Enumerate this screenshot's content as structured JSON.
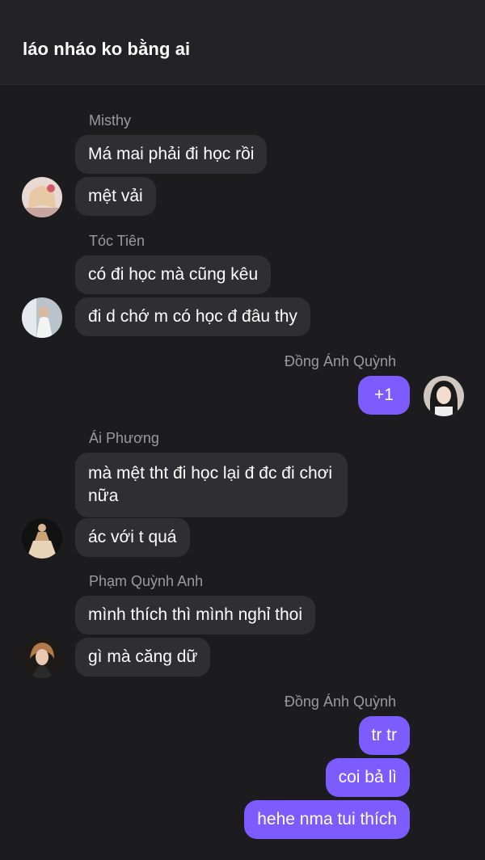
{
  "header": {
    "title": "láo nháo ko bằng ai"
  },
  "messages": {
    "g1": {
      "sender": "Misthy",
      "texts": [
        "Má mai phải đi học rồi",
        "mệt vải"
      ]
    },
    "g2": {
      "sender": "Tóc Tiên",
      "texts": [
        "có đi học mà cũng kêu",
        "đi d chớ m có học đ đâu thy"
      ]
    },
    "g3": {
      "sender": "Đồng Ánh Quỳnh",
      "texts": [
        "+1"
      ]
    },
    "g4": {
      "sender": "Ái Phương",
      "texts": [
        "mà mệt tht đi học lại đ đc đi chơi nữa",
        "ác với t quá"
      ]
    },
    "g5": {
      "sender": "Phạm Quỳnh Anh",
      "texts": [
        "mình thích thì mình nghỉ thoi",
        "gì mà căng dữ"
      ]
    },
    "g6": {
      "sender": "Đồng Ánh Quỳnh",
      "texts": [
        "tr tr",
        "coi bả lì",
        "hehe nma tui thích"
      ]
    }
  },
  "colors": {
    "outgoing": "#7c5cff",
    "incoming": "#2f2f33",
    "background": "#1c1c1e"
  }
}
